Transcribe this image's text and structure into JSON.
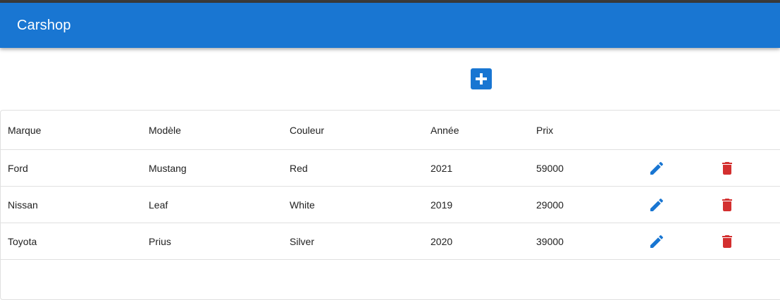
{
  "app": {
    "title": "Carshop"
  },
  "colors": {
    "primary": "#1976d2",
    "delete": "#d32f2f",
    "divider": "#e0e0e0"
  },
  "toolbar": {
    "add_icon": "plus-box-icon"
  },
  "table": {
    "columns": [
      "Marque",
      "Modèle",
      "Couleur",
      "Année",
      "Prix"
    ],
    "rows": [
      {
        "brand": "Ford",
        "model": "Mustang",
        "color": "Red",
        "year": "2021",
        "price": "59000"
      },
      {
        "brand": "Nissan",
        "model": "Leaf",
        "color": "White",
        "year": "2019",
        "price": "29000"
      },
      {
        "brand": "Toyota",
        "model": "Prius",
        "color": "Silver",
        "year": "2020",
        "price": "39000"
      }
    ],
    "edit_icon": "pencil-icon",
    "delete_icon": "trash-icon"
  }
}
